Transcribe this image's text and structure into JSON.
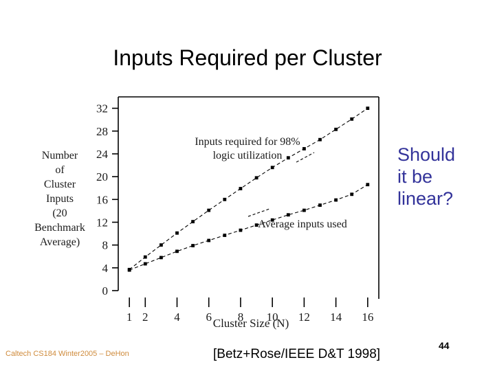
{
  "slide": {
    "title": "Inputs Required per Cluster",
    "page_number": "44"
  },
  "side_note": {
    "line1": "Should",
    "line2": "it be",
    "line3": "linear?",
    "color": "#33339a"
  },
  "footer": {
    "left": "Caltech CS184 Winter2005 – DeHon",
    "left_color": "#cf8b3c",
    "citation": "[Betz+Rose/IEEE D&T 1998]"
  },
  "chart_data": {
    "type": "line",
    "title": "",
    "xlabel": "Cluster Size (N)",
    "ylabel_lines": [
      "Number",
      "of",
      "Cluster",
      "Inputs",
      "(20",
      "Benchmark",
      "Average)"
    ],
    "xlim": [
      0.3,
      16.7
    ],
    "ylim": [
      0,
      34
    ],
    "xticks": [
      1,
      2,
      4,
      6,
      8,
      10,
      12,
      14,
      16
    ],
    "xticklabels": [
      "1",
      "2",
      "4",
      "6",
      "8",
      "10",
      "12",
      "14",
      "16"
    ],
    "yticks": [
      0,
      4,
      8,
      12,
      16,
      20,
      24,
      28,
      32
    ],
    "yticklabels": [
      "0",
      "4",
      "8",
      "12",
      "16",
      "20",
      "24",
      "28",
      "32"
    ],
    "grid": false,
    "legend": "annotations",
    "annotations": [
      {
        "text_line1": "Inputs required for 98%",
        "text_line2": "logic utilization",
        "target_series": "Inputs required for 98% logic utilization"
      },
      {
        "text_line1": "Average inputs used",
        "text_line2": "",
        "target_series": "Average inputs used"
      }
    ],
    "x": [
      1,
      2,
      3,
      4,
      5,
      6,
      7,
      8,
      9,
      10,
      11,
      12,
      13,
      14,
      15,
      16
    ],
    "series": [
      {
        "name": "Inputs required for 98% logic utilization",
        "marker": "square",
        "linestyle": "dashed",
        "values": [
          3.7,
          5.9,
          8.0,
          10.1,
          12.1,
          14.1,
          16.0,
          17.9,
          19.8,
          21.6,
          23.3,
          24.9,
          26.5,
          28.3,
          30.1,
          32.0
        ]
      },
      {
        "name": "Average inputs used",
        "marker": "square",
        "linestyle": "dashed",
        "values": [
          3.6,
          4.7,
          5.8,
          6.9,
          7.9,
          8.8,
          9.7,
          10.6,
          11.5,
          12.4,
          13.3,
          14.1,
          15.0,
          15.9,
          16.9,
          18.6
        ]
      }
    ]
  }
}
